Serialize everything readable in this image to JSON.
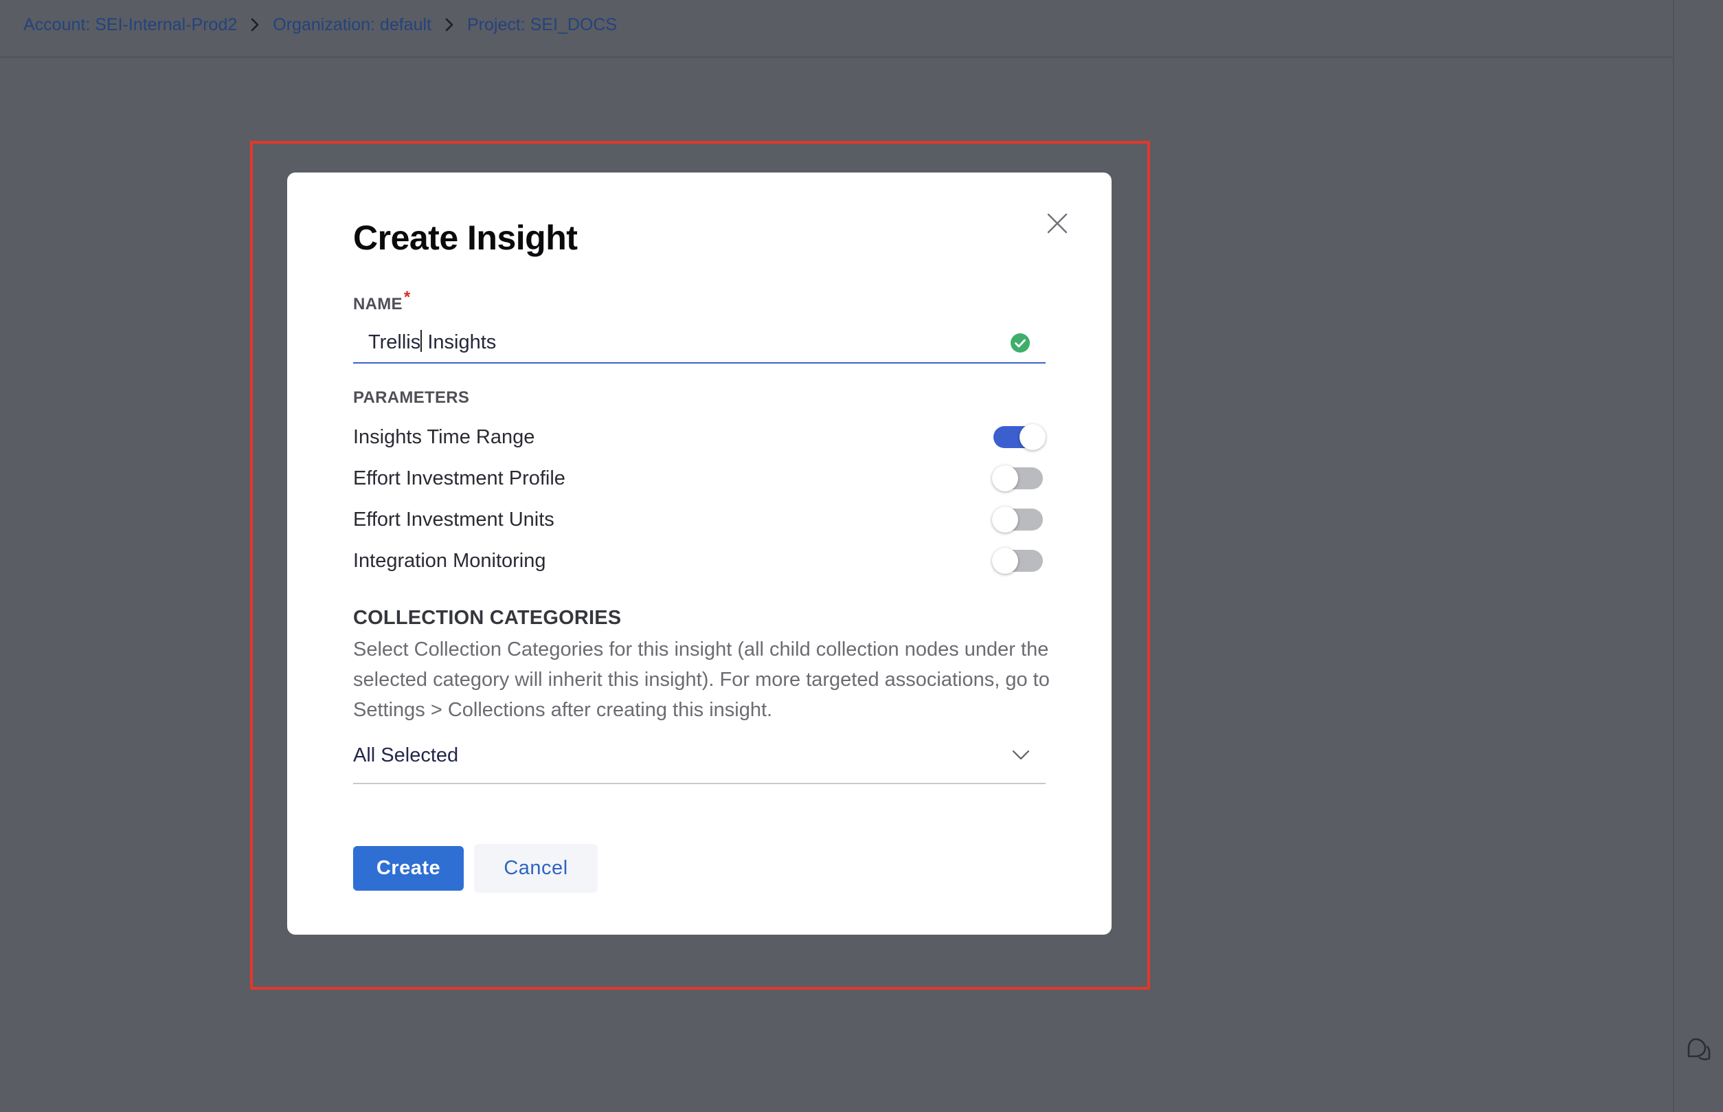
{
  "breadcrumb": {
    "account": "Account: SEI-Internal-Prod2",
    "organization": "Organization: default",
    "project": "Project: SEI_DOCS"
  },
  "modal": {
    "title": "Create Insight",
    "name_label": "NAME",
    "name_required_mark": "*",
    "name_value_before_cursor": "Trellis",
    "name_value_after_cursor": " Insights",
    "parameters_label": "PARAMETERS",
    "parameters": [
      {
        "label": "Insights Time Range",
        "enabled": true
      },
      {
        "label": "Effort Investment Profile",
        "enabled": false
      },
      {
        "label": "Effort Investment Units",
        "enabled": false
      },
      {
        "label": "Integration Monitoring",
        "enabled": false
      }
    ],
    "collection_categories_title": "COLLECTION CATEGORIES",
    "collection_categories_description": "Select Collection Categories for this insight (all child collection nodes under the selected category will inherit this insight). For more targeted associations, go to Settings > Collections after creating this insight.",
    "collection_categories_value": "All Selected",
    "create_label": "Create",
    "cancel_label": "Cancel"
  },
  "icons": {
    "close": "close-icon",
    "valid": "check-circle-icon",
    "dropdown": "chevron-down-icon",
    "chat": "chat-bubble-icon",
    "separator": "chevron-right-icon"
  },
  "colors": {
    "overlay": "#5a5d63",
    "accent": "#2f6fd3",
    "toggle_on": "#3c5fcf",
    "valid": "#3fae6a",
    "highlight": "#e3382b",
    "required": "#dd2a2a"
  }
}
